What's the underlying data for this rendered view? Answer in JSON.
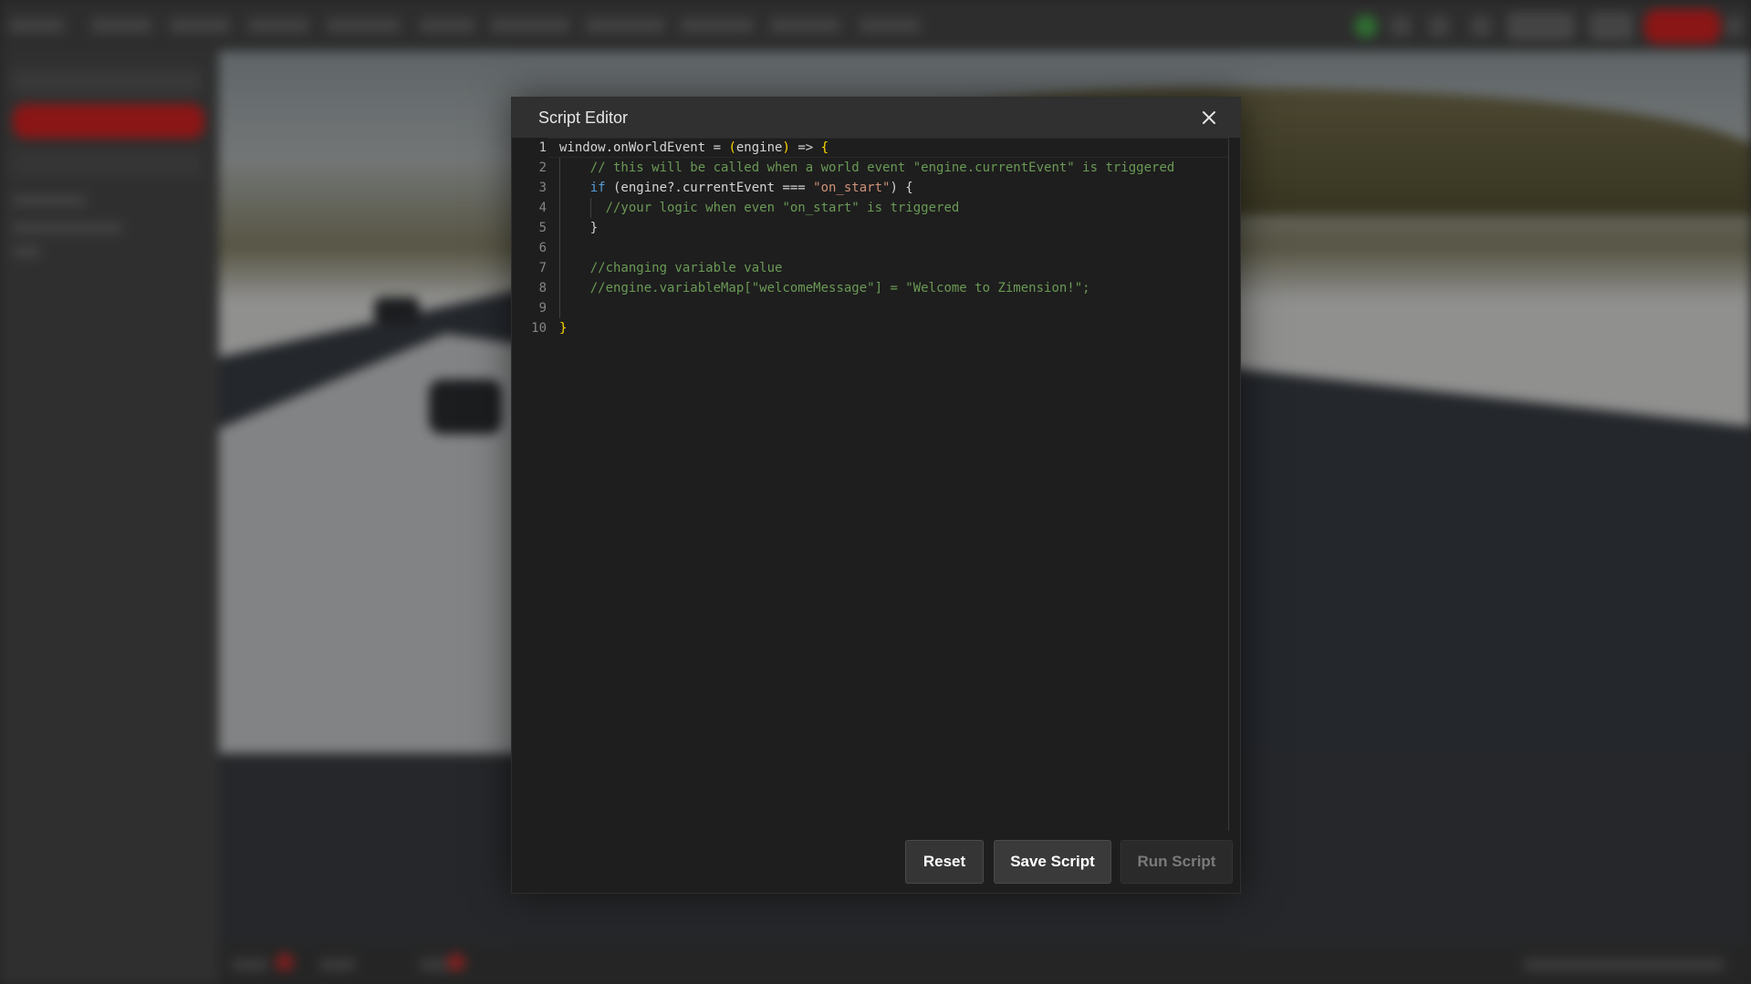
{
  "modal": {
    "title": "Script Editor",
    "close_icon": "close-icon",
    "buttons": {
      "reset": "Reset",
      "save": "Save Script",
      "run": "Run Script",
      "run_disabled": true
    }
  },
  "editor": {
    "active_line": 1,
    "lines": [
      {
        "num": "1",
        "tokens": [
          {
            "t": "window.onWorldEvent = ",
            "c": "white"
          },
          {
            "t": "(",
            "c": "yellow"
          },
          {
            "t": "engine",
            "c": "white"
          },
          {
            "t": ")",
            "c": "yellow"
          },
          {
            "t": " => ",
            "c": "white"
          },
          {
            "t": "{",
            "c": "yellow"
          }
        ]
      },
      {
        "num": "2",
        "tokens": [
          {
            "t": "    ",
            "c": "white"
          },
          {
            "t": "// this will be called when a world event \"engine.currentEvent\" is triggered",
            "c": "comment"
          }
        ]
      },
      {
        "num": "3",
        "tokens": [
          {
            "t": "    ",
            "c": "white"
          },
          {
            "t": "if",
            "c": "blue"
          },
          {
            "t": " (engine?.currentEvent === ",
            "c": "white"
          },
          {
            "t": "\"on_start\"",
            "c": "string"
          },
          {
            "t": ") {",
            "c": "white"
          }
        ]
      },
      {
        "num": "4",
        "tokens": [
          {
            "t": "      ",
            "c": "white"
          },
          {
            "t": "//your logic when even \"on_start\" is triggered",
            "c": "comment"
          }
        ]
      },
      {
        "num": "5",
        "tokens": [
          {
            "t": "    }",
            "c": "white"
          }
        ]
      },
      {
        "num": "6",
        "tokens": []
      },
      {
        "num": "7",
        "tokens": [
          {
            "t": "    ",
            "c": "white"
          },
          {
            "t": "//changing variable value",
            "c": "comment"
          }
        ]
      },
      {
        "num": "8",
        "tokens": [
          {
            "t": "    ",
            "c": "white"
          },
          {
            "t": "//engine.variableMap[\"welcomeMessage\"] = \"Welcome to Zimension!\";",
            "c": "comment"
          }
        ]
      },
      {
        "num": "9",
        "tokens": []
      },
      {
        "num": "10",
        "tokens": [
          {
            "t": "}",
            "c": "yellow"
          }
        ]
      }
    ]
  },
  "colors": {
    "accent_red": "#e02424",
    "status_green": "#4caf50",
    "comment": "#6a9955",
    "keyword": "#569cd6",
    "string": "#ce9178",
    "bracket": "#ffd700"
  }
}
